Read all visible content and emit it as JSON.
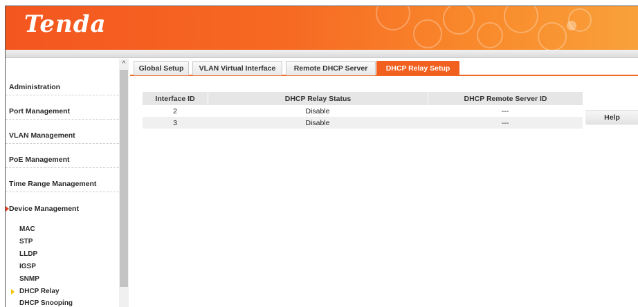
{
  "brand": {
    "logo_text": "Tenda",
    "accent_color": "#f2601f"
  },
  "sidebar": {
    "items": [
      {
        "label": "Administration"
      },
      {
        "label": "Port Management"
      },
      {
        "label": "VLAN Management"
      },
      {
        "label": "PoE Management"
      },
      {
        "label": "Time Range Management"
      },
      {
        "label": "Device Management",
        "expanded": true
      }
    ],
    "sub_items": [
      {
        "label": "MAC"
      },
      {
        "label": "STP"
      },
      {
        "label": "LLDP"
      },
      {
        "label": "IGSP"
      },
      {
        "label": "SNMP"
      },
      {
        "label": "DHCP Relay",
        "active": true
      },
      {
        "label": "DHCP Snooping"
      }
    ]
  },
  "tabs": [
    {
      "label": "Global Setup",
      "active": false
    },
    {
      "label": "VLAN Virtual Interface",
      "active": false
    },
    {
      "label": "Remote DHCP Server",
      "active": false
    },
    {
      "label": "DHCP Relay Setup",
      "active": true
    }
  ],
  "table": {
    "headers": [
      "Interface ID",
      "DHCP Relay Status",
      "DHCP Remote Server ID"
    ],
    "rows": [
      [
        "2",
        "Disable",
        "---"
      ],
      [
        "3",
        "Disable",
        "---"
      ]
    ]
  },
  "help_label": "Help"
}
